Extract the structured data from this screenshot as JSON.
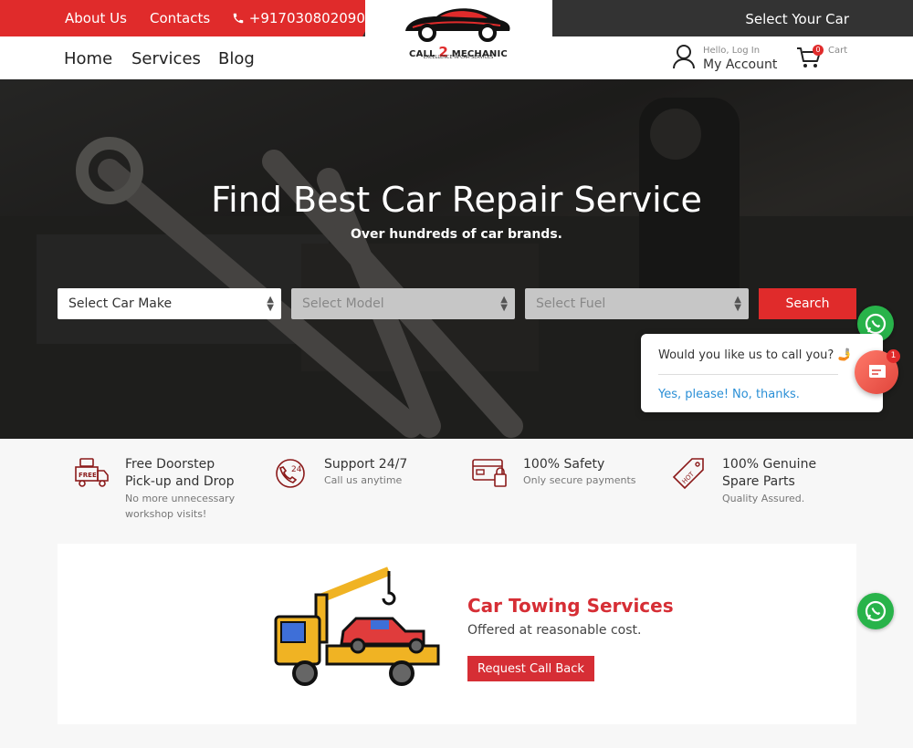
{
  "topbar": {
    "about": "About Us",
    "contacts": "Contacts",
    "phone": "+917030802090",
    "select_car": "Select Your Car"
  },
  "logo": {
    "text_left": "CALL",
    "text_num": "2",
    "text_right": "MECHANIC",
    "tagline": "EXCELLENCE IN CAR SERVICES"
  },
  "nav": {
    "items": [
      "Home",
      "Services",
      "Blog"
    ],
    "account_hello": "Hello, Log In",
    "account_label": "My Account",
    "cart_count": "0",
    "cart_label": "Cart"
  },
  "hero": {
    "title": "Find Best Car Repair Service",
    "subtitle": "Over hundreds of car brands.",
    "make_placeholder": "Select Car Make",
    "model_placeholder": "Select Model",
    "fuel_placeholder": "Select Fuel",
    "search_label": "Search"
  },
  "popup": {
    "question": "Would you like us to call you? 🤳",
    "yes": "Yes, please!",
    "no": "No, thanks.",
    "badge": "1"
  },
  "features": [
    {
      "title": "Free Doorstep Pick-up and Drop",
      "desc": "No more unnecessary workshop visits!",
      "icon": "free-van-icon"
    },
    {
      "title": "Support 24/7",
      "desc": "Call us anytime",
      "icon": "support-24-icon"
    },
    {
      "title": "100% Safety",
      "desc": "Only secure payments",
      "icon": "secure-card-icon"
    },
    {
      "title": "100% Genuine Spare Parts",
      "desc": "Quality Assured.",
      "icon": "hot-tag-icon"
    }
  ],
  "towing": {
    "title": "Car Towing Services",
    "subtitle": "Offered at reasonable cost.",
    "button": "Request Call Back"
  },
  "colors": {
    "brand_red": "#e02b2b",
    "dark": "#333333",
    "whatsapp": "#28b34a"
  }
}
